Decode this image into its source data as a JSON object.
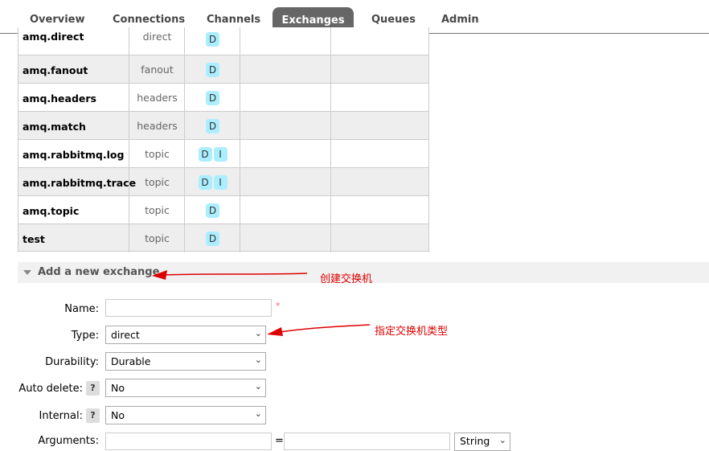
{
  "tabs": [
    {
      "label": "Overview"
    },
    {
      "label": "Connections"
    },
    {
      "label": "Channels"
    },
    {
      "label": "Exchanges"
    },
    {
      "label": "Queues"
    },
    {
      "label": "Admin"
    }
  ],
  "active_tab": "Exchanges",
  "exchanges": [
    {
      "name": "amq.direct",
      "type": "direct",
      "features": [
        "D"
      ]
    },
    {
      "name": "amq.fanout",
      "type": "fanout",
      "features": [
        "D"
      ]
    },
    {
      "name": "amq.headers",
      "type": "headers",
      "features": [
        "D"
      ]
    },
    {
      "name": "amq.match",
      "type": "headers",
      "features": [
        "D"
      ]
    },
    {
      "name": "amq.rabbitmq.log",
      "type": "topic",
      "features": [
        "D",
        "I"
      ]
    },
    {
      "name": "amq.rabbitmq.trace",
      "type": "topic",
      "features": [
        "D",
        "I"
      ]
    },
    {
      "name": "amq.topic",
      "type": "topic",
      "features": [
        "D"
      ]
    },
    {
      "name": "test",
      "type": "topic",
      "features": [
        "D"
      ]
    }
  ],
  "add_section": {
    "title": "Add a new exchange",
    "name_label": "Name:",
    "name_value": "",
    "required_mark": "*",
    "type_label": "Type:",
    "type_value": "direct",
    "durability_label": "Durability:",
    "durability_value": "Durable",
    "auto_delete_label": "Auto delete:",
    "auto_delete_value": "No",
    "internal_label": "Internal:",
    "internal_value": "No",
    "arguments_label": "Arguments:",
    "arguments_equals": "=",
    "arguments_type_value": "String",
    "help_mark": "?"
  },
  "annotations": {
    "create_exchange": "创建交换机",
    "specify_type": "指定交换机类型"
  },
  "colors": {
    "active_tab_bg": "#666666",
    "badge_bg": "#aaeeff",
    "annotation": "#dd0000"
  }
}
